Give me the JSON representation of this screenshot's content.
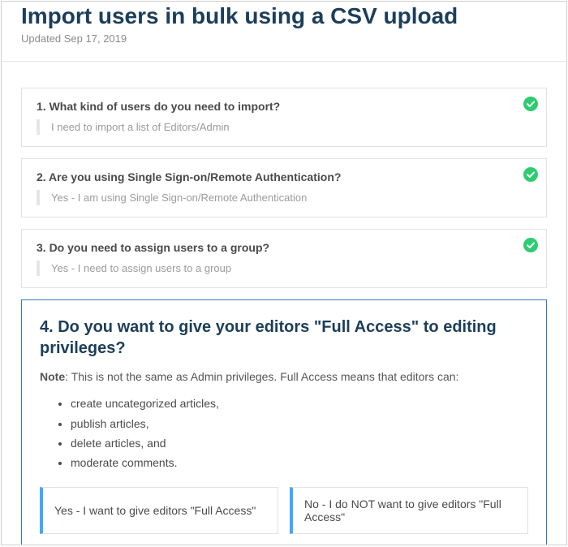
{
  "header": {
    "title": "Import users in bulk using a CSV upload",
    "updated": "Updated Sep 17, 2019"
  },
  "steps": {
    "completed": [
      {
        "question": "1. What kind of users do you need to import?",
        "answer": "I need to import a list of Editors/Admin"
      },
      {
        "question": "2. Are you using Single Sign-on/Remote Authentication?",
        "answer": "Yes - I am using Single Sign-on/Remote Authentication"
      },
      {
        "question": "3. Do you need to assign users to a group?",
        "answer": "Yes - I need to assign users to a group"
      }
    ],
    "active": {
      "question": "4. Do you want to give your editors \"Full Access\" to editing privileges?",
      "noteLabel": "Note",
      "noteText": ": This is not the same as Admin privileges. Full Access means that editors can:",
      "bullets": [
        "create uncategorized articles,",
        "publish articles,",
        "delete articles, and",
        "moderate comments."
      ],
      "options": {
        "yes": "Yes - I want to give editors \"Full Access\"",
        "no": "No - I do NOT want to give editors \"Full Access\""
      }
    }
  }
}
